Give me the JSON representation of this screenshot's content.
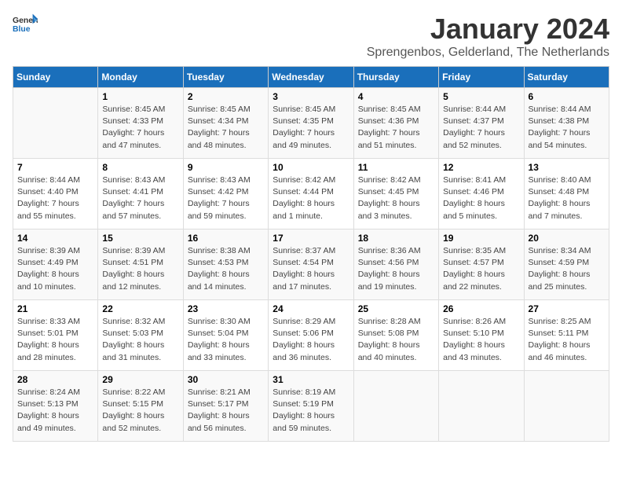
{
  "header": {
    "logo_general": "General",
    "logo_blue": "Blue",
    "month": "January 2024",
    "location": "Sprengenbos, Gelderland, The Netherlands"
  },
  "weekdays": [
    "Sunday",
    "Monday",
    "Tuesday",
    "Wednesday",
    "Thursday",
    "Friday",
    "Saturday"
  ],
  "weeks": [
    [
      {
        "day": "",
        "detail": ""
      },
      {
        "day": "1",
        "detail": "Sunrise: 8:45 AM\nSunset: 4:33 PM\nDaylight: 7 hours\nand 47 minutes."
      },
      {
        "day": "2",
        "detail": "Sunrise: 8:45 AM\nSunset: 4:34 PM\nDaylight: 7 hours\nand 48 minutes."
      },
      {
        "day": "3",
        "detail": "Sunrise: 8:45 AM\nSunset: 4:35 PM\nDaylight: 7 hours\nand 49 minutes."
      },
      {
        "day": "4",
        "detail": "Sunrise: 8:45 AM\nSunset: 4:36 PM\nDaylight: 7 hours\nand 51 minutes."
      },
      {
        "day": "5",
        "detail": "Sunrise: 8:44 AM\nSunset: 4:37 PM\nDaylight: 7 hours\nand 52 minutes."
      },
      {
        "day": "6",
        "detail": "Sunrise: 8:44 AM\nSunset: 4:38 PM\nDaylight: 7 hours\nand 54 minutes."
      }
    ],
    [
      {
        "day": "7",
        "detail": "Sunrise: 8:44 AM\nSunset: 4:40 PM\nDaylight: 7 hours\nand 55 minutes."
      },
      {
        "day": "8",
        "detail": "Sunrise: 8:43 AM\nSunset: 4:41 PM\nDaylight: 7 hours\nand 57 minutes."
      },
      {
        "day": "9",
        "detail": "Sunrise: 8:43 AM\nSunset: 4:42 PM\nDaylight: 7 hours\nand 59 minutes."
      },
      {
        "day": "10",
        "detail": "Sunrise: 8:42 AM\nSunset: 4:44 PM\nDaylight: 8 hours\nand 1 minute."
      },
      {
        "day": "11",
        "detail": "Sunrise: 8:42 AM\nSunset: 4:45 PM\nDaylight: 8 hours\nand 3 minutes."
      },
      {
        "day": "12",
        "detail": "Sunrise: 8:41 AM\nSunset: 4:46 PM\nDaylight: 8 hours\nand 5 minutes."
      },
      {
        "day": "13",
        "detail": "Sunrise: 8:40 AM\nSunset: 4:48 PM\nDaylight: 8 hours\nand 7 minutes."
      }
    ],
    [
      {
        "day": "14",
        "detail": "Sunrise: 8:39 AM\nSunset: 4:49 PM\nDaylight: 8 hours\nand 10 minutes."
      },
      {
        "day": "15",
        "detail": "Sunrise: 8:39 AM\nSunset: 4:51 PM\nDaylight: 8 hours\nand 12 minutes."
      },
      {
        "day": "16",
        "detail": "Sunrise: 8:38 AM\nSunset: 4:53 PM\nDaylight: 8 hours\nand 14 minutes."
      },
      {
        "day": "17",
        "detail": "Sunrise: 8:37 AM\nSunset: 4:54 PM\nDaylight: 8 hours\nand 17 minutes."
      },
      {
        "day": "18",
        "detail": "Sunrise: 8:36 AM\nSunset: 4:56 PM\nDaylight: 8 hours\nand 19 minutes."
      },
      {
        "day": "19",
        "detail": "Sunrise: 8:35 AM\nSunset: 4:57 PM\nDaylight: 8 hours\nand 22 minutes."
      },
      {
        "day": "20",
        "detail": "Sunrise: 8:34 AM\nSunset: 4:59 PM\nDaylight: 8 hours\nand 25 minutes."
      }
    ],
    [
      {
        "day": "21",
        "detail": "Sunrise: 8:33 AM\nSunset: 5:01 PM\nDaylight: 8 hours\nand 28 minutes."
      },
      {
        "day": "22",
        "detail": "Sunrise: 8:32 AM\nSunset: 5:03 PM\nDaylight: 8 hours\nand 31 minutes."
      },
      {
        "day": "23",
        "detail": "Sunrise: 8:30 AM\nSunset: 5:04 PM\nDaylight: 8 hours\nand 33 minutes."
      },
      {
        "day": "24",
        "detail": "Sunrise: 8:29 AM\nSunset: 5:06 PM\nDaylight: 8 hours\nand 36 minutes."
      },
      {
        "day": "25",
        "detail": "Sunrise: 8:28 AM\nSunset: 5:08 PM\nDaylight: 8 hours\nand 40 minutes."
      },
      {
        "day": "26",
        "detail": "Sunrise: 8:26 AM\nSunset: 5:10 PM\nDaylight: 8 hours\nand 43 minutes."
      },
      {
        "day": "27",
        "detail": "Sunrise: 8:25 AM\nSunset: 5:11 PM\nDaylight: 8 hours\nand 46 minutes."
      }
    ],
    [
      {
        "day": "28",
        "detail": "Sunrise: 8:24 AM\nSunset: 5:13 PM\nDaylight: 8 hours\nand 49 minutes."
      },
      {
        "day": "29",
        "detail": "Sunrise: 8:22 AM\nSunset: 5:15 PM\nDaylight: 8 hours\nand 52 minutes."
      },
      {
        "day": "30",
        "detail": "Sunrise: 8:21 AM\nSunset: 5:17 PM\nDaylight: 8 hours\nand 56 minutes."
      },
      {
        "day": "31",
        "detail": "Sunrise: 8:19 AM\nSunset: 5:19 PM\nDaylight: 8 hours\nand 59 minutes."
      },
      {
        "day": "",
        "detail": ""
      },
      {
        "day": "",
        "detail": ""
      },
      {
        "day": "",
        "detail": ""
      }
    ]
  ]
}
